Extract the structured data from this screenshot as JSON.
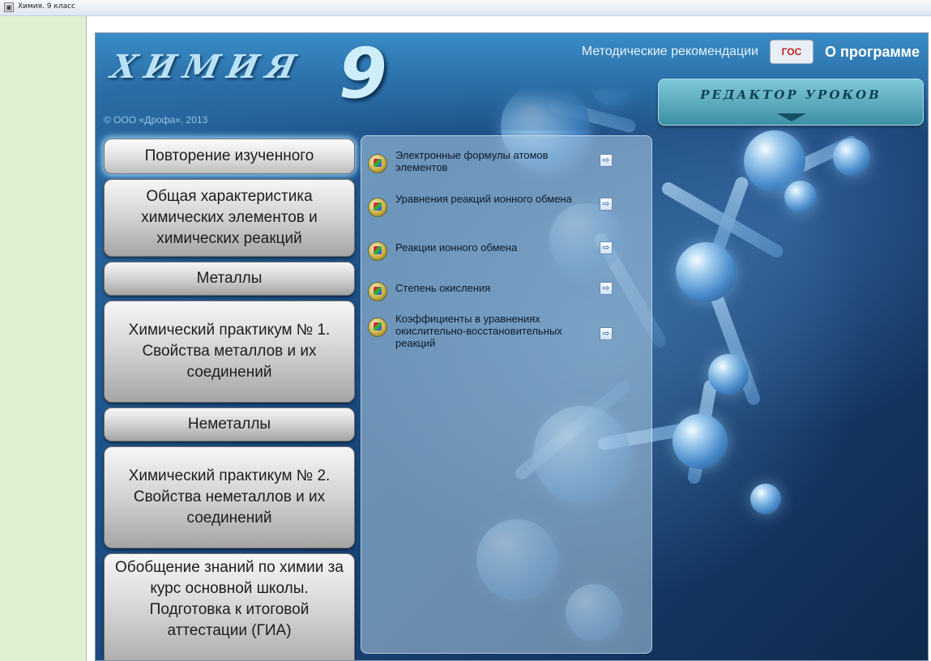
{
  "window": {
    "title": "Химия. 9 класс",
    "icon": "app-icon"
  },
  "header": {
    "logo_text": "ХИМИЯ",
    "logo_number": "9",
    "copyright": "© ООО «Дрофа», 2013",
    "methodical_link": "Методические рекомендации",
    "fgos_badge": "ГОС",
    "about_link": "О программе",
    "editor_button": "РЕДАКТОР УРОКОВ"
  },
  "menu": {
    "items": [
      {
        "label": "Повторение изученного"
      },
      {
        "label": "Общая характеристика химических элементов и химических реакций"
      },
      {
        "label": "Металлы"
      },
      {
        "label": "Химический практикум № 1. Свойства металлов и их соединений"
      },
      {
        "label": "Неметаллы"
      },
      {
        "label": "Химический практикум № 2. Свойства неметаллов и их соединений"
      },
      {
        "label": "Обобщение знаний по химии за курс основной школы. Подготовка к итоговой аттестации (ГИА)"
      }
    ]
  },
  "topics": {
    "items": [
      {
        "label": "Электронные формулы атомов элементов"
      },
      {
        "label": "Уравнения реакций ионного обмена"
      },
      {
        "label": "Реакции ионного обмена"
      },
      {
        "label": "Степень окисления"
      },
      {
        "label": "Коэффициенты в уравнениях окислительно-восстановительных реакций"
      }
    ]
  },
  "colors": {
    "accent": "#9fdcff",
    "left_pane": "#dff0d2",
    "background": "#1c4e84"
  }
}
